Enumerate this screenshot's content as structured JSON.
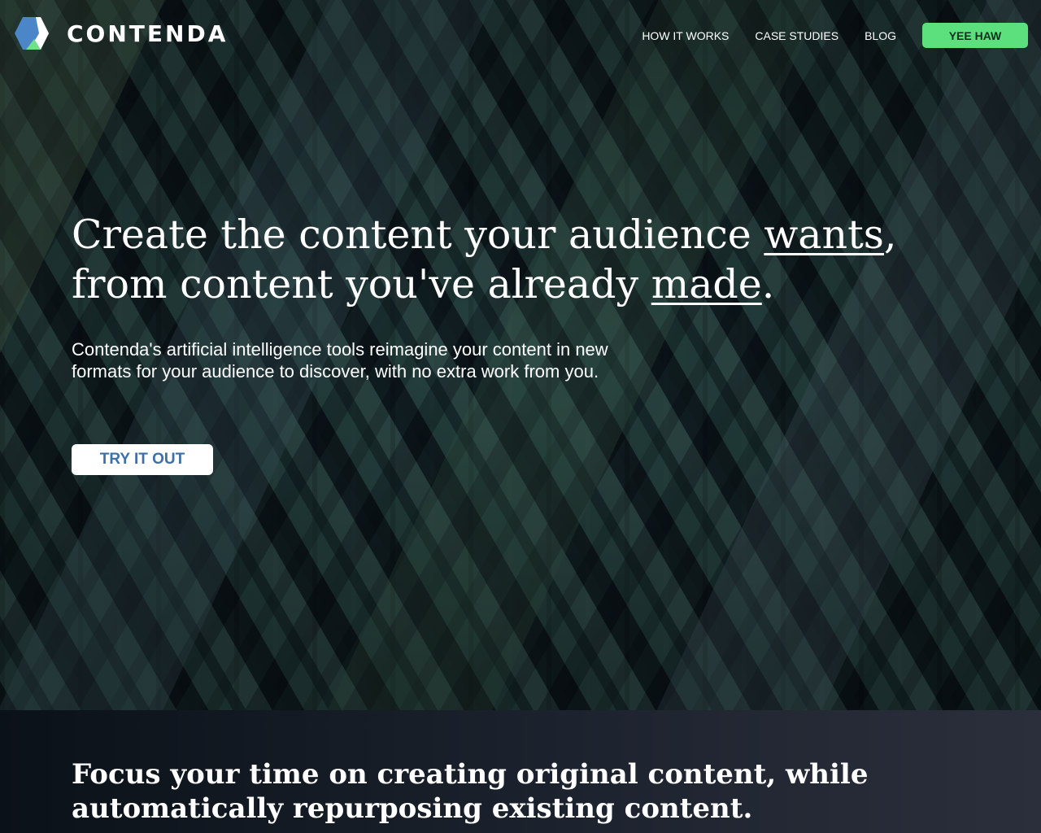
{
  "brand": {
    "name": "CONTENDA",
    "colors": {
      "logo_blue": "#4a86c8",
      "logo_green": "#6fe08b",
      "logo_white": "#ffffff",
      "accent_green": "#5be07d",
      "button_text_blue": "#3e6fa8"
    }
  },
  "nav": {
    "links": [
      "HOW IT WORKS",
      "CASE STUDIES",
      "BLOG"
    ],
    "cta_label": "YEE HAW"
  },
  "hero": {
    "headline": {
      "part1": "Create the content your audience ",
      "emphasis1": "wants",
      "part2": ",",
      "part3": "from content you've already ",
      "emphasis2": "made",
      "part4": "."
    },
    "subtext": "Contenda's artificial intelligence tools reimagine your content in new formats for your audience to discover, with no extra work from you.",
    "button_label": "TRY IT OUT"
  },
  "band": {
    "title": "Focus your time on creating original content, while automatically repurposing existing content."
  }
}
